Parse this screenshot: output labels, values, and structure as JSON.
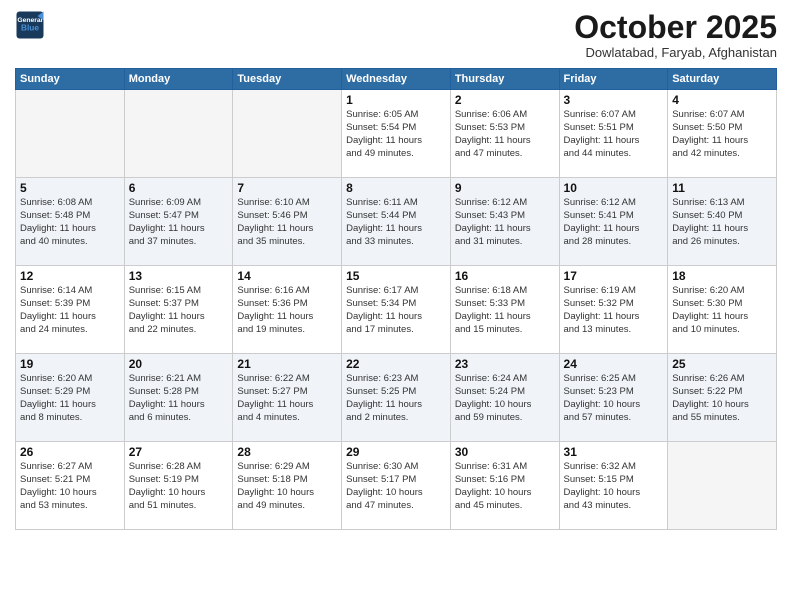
{
  "logo": {
    "line1": "General",
    "line2": "Blue"
  },
  "title": "October 2025",
  "location": "Dowlatabad, Faryab, Afghanistan",
  "weekdays": [
    "Sunday",
    "Monday",
    "Tuesday",
    "Wednesday",
    "Thursday",
    "Friday",
    "Saturday"
  ],
  "weeks": [
    [
      {
        "day": "",
        "info": ""
      },
      {
        "day": "",
        "info": ""
      },
      {
        "day": "",
        "info": ""
      },
      {
        "day": "1",
        "info": "Sunrise: 6:05 AM\nSunset: 5:54 PM\nDaylight: 11 hours\nand 49 minutes."
      },
      {
        "day": "2",
        "info": "Sunrise: 6:06 AM\nSunset: 5:53 PM\nDaylight: 11 hours\nand 47 minutes."
      },
      {
        "day": "3",
        "info": "Sunrise: 6:07 AM\nSunset: 5:51 PM\nDaylight: 11 hours\nand 44 minutes."
      },
      {
        "day": "4",
        "info": "Sunrise: 6:07 AM\nSunset: 5:50 PM\nDaylight: 11 hours\nand 42 minutes."
      }
    ],
    [
      {
        "day": "5",
        "info": "Sunrise: 6:08 AM\nSunset: 5:48 PM\nDaylight: 11 hours\nand 40 minutes."
      },
      {
        "day": "6",
        "info": "Sunrise: 6:09 AM\nSunset: 5:47 PM\nDaylight: 11 hours\nand 37 minutes."
      },
      {
        "day": "7",
        "info": "Sunrise: 6:10 AM\nSunset: 5:46 PM\nDaylight: 11 hours\nand 35 minutes."
      },
      {
        "day": "8",
        "info": "Sunrise: 6:11 AM\nSunset: 5:44 PM\nDaylight: 11 hours\nand 33 minutes."
      },
      {
        "day": "9",
        "info": "Sunrise: 6:12 AM\nSunset: 5:43 PM\nDaylight: 11 hours\nand 31 minutes."
      },
      {
        "day": "10",
        "info": "Sunrise: 6:12 AM\nSunset: 5:41 PM\nDaylight: 11 hours\nand 28 minutes."
      },
      {
        "day": "11",
        "info": "Sunrise: 6:13 AM\nSunset: 5:40 PM\nDaylight: 11 hours\nand 26 minutes."
      }
    ],
    [
      {
        "day": "12",
        "info": "Sunrise: 6:14 AM\nSunset: 5:39 PM\nDaylight: 11 hours\nand 24 minutes."
      },
      {
        "day": "13",
        "info": "Sunrise: 6:15 AM\nSunset: 5:37 PM\nDaylight: 11 hours\nand 22 minutes."
      },
      {
        "day": "14",
        "info": "Sunrise: 6:16 AM\nSunset: 5:36 PM\nDaylight: 11 hours\nand 19 minutes."
      },
      {
        "day": "15",
        "info": "Sunrise: 6:17 AM\nSunset: 5:34 PM\nDaylight: 11 hours\nand 17 minutes."
      },
      {
        "day": "16",
        "info": "Sunrise: 6:18 AM\nSunset: 5:33 PM\nDaylight: 11 hours\nand 15 minutes."
      },
      {
        "day": "17",
        "info": "Sunrise: 6:19 AM\nSunset: 5:32 PM\nDaylight: 11 hours\nand 13 minutes."
      },
      {
        "day": "18",
        "info": "Sunrise: 6:20 AM\nSunset: 5:30 PM\nDaylight: 11 hours\nand 10 minutes."
      }
    ],
    [
      {
        "day": "19",
        "info": "Sunrise: 6:20 AM\nSunset: 5:29 PM\nDaylight: 11 hours\nand 8 minutes."
      },
      {
        "day": "20",
        "info": "Sunrise: 6:21 AM\nSunset: 5:28 PM\nDaylight: 11 hours\nand 6 minutes."
      },
      {
        "day": "21",
        "info": "Sunrise: 6:22 AM\nSunset: 5:27 PM\nDaylight: 11 hours\nand 4 minutes."
      },
      {
        "day": "22",
        "info": "Sunrise: 6:23 AM\nSunset: 5:25 PM\nDaylight: 11 hours\nand 2 minutes."
      },
      {
        "day": "23",
        "info": "Sunrise: 6:24 AM\nSunset: 5:24 PM\nDaylight: 10 hours\nand 59 minutes."
      },
      {
        "day": "24",
        "info": "Sunrise: 6:25 AM\nSunset: 5:23 PM\nDaylight: 10 hours\nand 57 minutes."
      },
      {
        "day": "25",
        "info": "Sunrise: 6:26 AM\nSunset: 5:22 PM\nDaylight: 10 hours\nand 55 minutes."
      }
    ],
    [
      {
        "day": "26",
        "info": "Sunrise: 6:27 AM\nSunset: 5:21 PM\nDaylight: 10 hours\nand 53 minutes."
      },
      {
        "day": "27",
        "info": "Sunrise: 6:28 AM\nSunset: 5:19 PM\nDaylight: 10 hours\nand 51 minutes."
      },
      {
        "day": "28",
        "info": "Sunrise: 6:29 AM\nSunset: 5:18 PM\nDaylight: 10 hours\nand 49 minutes."
      },
      {
        "day": "29",
        "info": "Sunrise: 6:30 AM\nSunset: 5:17 PM\nDaylight: 10 hours\nand 47 minutes."
      },
      {
        "day": "30",
        "info": "Sunrise: 6:31 AM\nSunset: 5:16 PM\nDaylight: 10 hours\nand 45 minutes."
      },
      {
        "day": "31",
        "info": "Sunrise: 6:32 AM\nSunset: 5:15 PM\nDaylight: 10 hours\nand 43 minutes."
      },
      {
        "day": "",
        "info": ""
      }
    ]
  ]
}
